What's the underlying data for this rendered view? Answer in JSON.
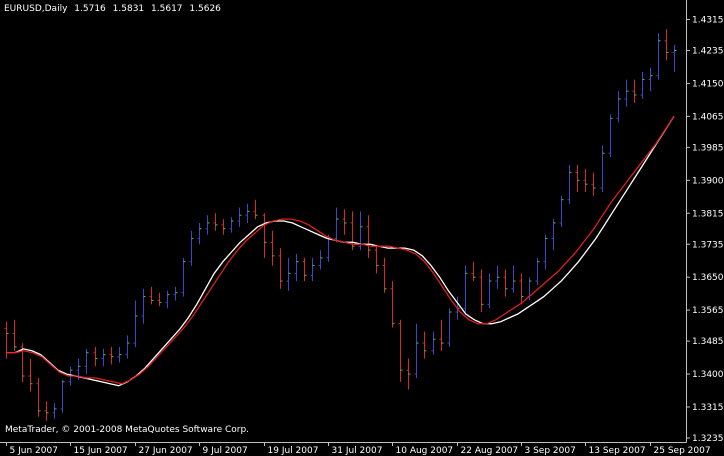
{
  "header": {
    "symbol": "EURUSD,Daily",
    "open": "1.5716",
    "high": "1.5831",
    "low": "1.5617",
    "close": "1.5626"
  },
  "copyright": "MetaTrader, © 2001-2008 MetaQuotes Software Corp.",
  "colors": {
    "background": "#000000",
    "axis": "#c0c0c0",
    "bar_up": "#3e45c8",
    "bar_down": "#d62a2a",
    "close_tick": "#3fd23f",
    "ma_fast": "#ffffff",
    "ma_slow": "#e01e1e"
  },
  "chart_data": {
    "type": "ohlc",
    "ylim": [
      1.3235,
      1.4355
    ],
    "y_ticks": [
      "1.4315",
      "1.4235",
      "1.4150",
      "1.4065",
      "1.3985",
      "1.3900",
      "1.3815",
      "1.3735",
      "1.3650",
      "1.3565",
      "1.3485",
      "1.3400",
      "1.3315",
      "1.3235"
    ],
    "x_tick_labels": [
      "5 Jun 2007",
      "15 Jun 2007",
      "27 Jun 2007",
      "9 Jul 2007",
      "19 Jul 2007",
      "31 Jul 2007",
      "10 Aug 2007",
      "22 Aug 2007",
      "3 Sep 2007",
      "13 Sep 2007",
      "25 Sep 2007"
    ],
    "x_tick_bar_index": [
      0,
      8,
      16,
      24,
      32,
      40,
      48,
      56,
      64,
      72,
      80
    ],
    "bars": [
      [
        1.3518,
        1.3535,
        1.344,
        1.3505
      ],
      [
        1.3505,
        1.354,
        1.346,
        1.347
      ],
      [
        1.347,
        1.348,
        1.338,
        1.3395
      ],
      [
        1.3395,
        1.344,
        1.3355,
        1.3375
      ],
      [
        1.3375,
        1.339,
        1.329,
        1.3305
      ],
      [
        1.3305,
        1.333,
        1.328,
        1.33
      ],
      [
        1.33,
        1.3325,
        1.3285,
        1.331
      ],
      [
        1.331,
        1.3385,
        1.33,
        1.338
      ],
      [
        1.338,
        1.342,
        1.337,
        1.341
      ],
      [
        1.341,
        1.344,
        1.3385,
        1.342
      ],
      [
        1.342,
        1.3465,
        1.34,
        1.3455
      ],
      [
        1.3455,
        1.347,
        1.342,
        1.344
      ],
      [
        1.344,
        1.3465,
        1.342,
        1.345
      ],
      [
        1.345,
        1.347,
        1.3425,
        1.3445
      ],
      [
        1.3445,
        1.347,
        1.343,
        1.345
      ],
      [
        1.345,
        1.35,
        1.344,
        1.348
      ],
      [
        1.348,
        1.359,
        1.347,
        1.355
      ],
      [
        1.355,
        1.362,
        1.353,
        1.36
      ],
      [
        1.36,
        1.3625,
        1.358,
        1.359
      ],
      [
        1.359,
        1.361,
        1.3575,
        1.3585
      ],
      [
        1.3585,
        1.3615,
        1.357,
        1.3605
      ],
      [
        1.3605,
        1.3625,
        1.359,
        1.361
      ],
      [
        1.361,
        1.37,
        1.36,
        1.369
      ],
      [
        1.369,
        1.377,
        1.368,
        1.375
      ],
      [
        1.375,
        1.379,
        1.3735,
        1.3775
      ],
      [
        1.3775,
        1.381,
        1.376,
        1.379
      ],
      [
        1.379,
        1.3815,
        1.377,
        1.3785
      ],
      [
        1.3785,
        1.38,
        1.376,
        1.3775
      ],
      [
        1.3775,
        1.3805,
        1.3765,
        1.3795
      ],
      [
        1.3795,
        1.383,
        1.378,
        1.381
      ],
      [
        1.381,
        1.384,
        1.379,
        1.382
      ],
      [
        1.382,
        1.385,
        1.38,
        1.381
      ],
      [
        1.381,
        1.3815,
        1.37,
        1.374
      ],
      [
        1.374,
        1.377,
        1.368,
        1.3705
      ],
      [
        1.3705,
        1.3725,
        1.362,
        1.364
      ],
      [
        1.364,
        1.37,
        1.3615,
        1.366
      ],
      [
        1.366,
        1.371,
        1.364,
        1.369
      ],
      [
        1.369,
        1.37,
        1.364,
        1.3655
      ],
      [
        1.3655,
        1.37,
        1.364,
        1.368
      ],
      [
        1.368,
        1.372,
        1.367,
        1.37
      ],
      [
        1.37,
        1.376,
        1.369,
        1.375
      ],
      [
        1.375,
        1.383,
        1.374,
        1.38
      ],
      [
        1.38,
        1.3825,
        1.376,
        1.379
      ],
      [
        1.379,
        1.382,
        1.372,
        1.373
      ],
      [
        1.373,
        1.382,
        1.372,
        1.378
      ],
      [
        1.378,
        1.381,
        1.37,
        1.372
      ],
      [
        1.372,
        1.373,
        1.366,
        1.368
      ],
      [
        1.368,
        1.37,
        1.361,
        1.362
      ],
      [
        1.362,
        1.364,
        1.352,
        1.353
      ],
      [
        1.353,
        1.354,
        1.338,
        1.341
      ],
      [
        1.341,
        1.344,
        1.336,
        1.34
      ],
      [
        1.34,
        1.353,
        1.339,
        1.348
      ],
      [
        1.348,
        1.351,
        1.344,
        1.346
      ],
      [
        1.346,
        1.351,
        1.345,
        1.349
      ],
      [
        1.349,
        1.354,
        1.346,
        1.348
      ],
      [
        1.348,
        1.357,
        1.347,
        1.356
      ],
      [
        1.356,
        1.36,
        1.354,
        1.357
      ],
      [
        1.357,
        1.368,
        1.356,
        1.366
      ],
      [
        1.366,
        1.369,
        1.364,
        1.365
      ],
      [
        1.365,
        1.367,
        1.356,
        1.358
      ],
      [
        1.358,
        1.366,
        1.357,
        1.364
      ],
      [
        1.364,
        1.368,
        1.362,
        1.365
      ],
      [
        1.365,
        1.367,
        1.36,
        1.362
      ],
      [
        1.362,
        1.368,
        1.361,
        1.364
      ],
      [
        1.364,
        1.366,
        1.358,
        1.36
      ],
      [
        1.36,
        1.365,
        1.359,
        1.364
      ],
      [
        1.364,
        1.37,
        1.363,
        1.369
      ],
      [
        1.369,
        1.376,
        1.367,
        1.375
      ],
      [
        1.375,
        1.38,
        1.372,
        1.379
      ],
      [
        1.379,
        1.386,
        1.378,
        1.385
      ],
      [
        1.385,
        1.394,
        1.384,
        1.392
      ],
      [
        1.392,
        1.394,
        1.387,
        1.39
      ],
      [
        1.39,
        1.393,
        1.387,
        1.389
      ],
      [
        1.389,
        1.392,
        1.386,
        1.388
      ],
      [
        1.388,
        1.399,
        1.387,
        1.397
      ],
      [
        1.397,
        1.407,
        1.396,
        1.406
      ],
      [
        1.406,
        1.413,
        1.405,
        1.411
      ],
      [
        1.411,
        1.416,
        1.409,
        1.413
      ],
      [
        1.413,
        1.416,
        1.41,
        1.412
      ],
      [
        1.412,
        1.418,
        1.411,
        1.416
      ],
      [
        1.416,
        1.419,
        1.413,
        1.417
      ],
      [
        1.417,
        1.428,
        1.416,
        1.426
      ],
      [
        1.426,
        1.429,
        1.421,
        1.423
      ],
      [
        1.423,
        1.425,
        1.418,
        1.4235
      ]
    ],
    "series": [
      {
        "values": [
          1.3455,
          1.3455,
          1.3465,
          1.346,
          1.345,
          1.343,
          1.341,
          1.34,
          1.3395,
          1.339,
          1.3385,
          1.338,
          1.3375,
          1.337,
          1.338,
          1.3395,
          1.3415,
          1.344,
          1.3465,
          1.349,
          1.3515,
          1.3545,
          1.358,
          1.362,
          1.366,
          1.369,
          1.3715,
          1.374,
          1.376,
          1.378,
          1.379,
          1.3795,
          1.3795,
          1.379,
          1.378,
          1.377,
          1.376,
          1.375,
          1.3745,
          1.374,
          1.374,
          1.3735,
          1.3735,
          1.373,
          1.3725,
          1.3725,
          1.3725,
          1.372,
          1.3705,
          1.368,
          1.365,
          1.3615,
          1.3585,
          1.3555,
          1.354,
          1.353,
          1.353,
          1.3535,
          1.3545,
          1.3555,
          1.357,
          1.3585,
          1.36,
          1.362,
          1.364,
          1.3665,
          1.369,
          1.372,
          1.375,
          1.3785,
          1.382,
          1.3855,
          1.389,
          1.3925,
          1.396,
          1.3995,
          1.403,
          1.4065
        ]
      },
      {
        "values": [
          1.3455,
          1.3455,
          1.346,
          1.3455,
          1.3445,
          1.3425,
          1.3405,
          1.3395,
          1.3395,
          1.339,
          1.339,
          1.3385,
          1.338,
          1.3375,
          1.3385,
          1.34,
          1.342,
          1.3445,
          1.347,
          1.3495,
          1.352,
          1.355,
          1.3585,
          1.362,
          1.3655,
          1.369,
          1.372,
          1.3745,
          1.3765,
          1.3785,
          1.3795,
          1.38,
          1.38,
          1.3795,
          1.3785,
          1.377,
          1.3755,
          1.3745,
          1.374,
          1.3735,
          1.3735,
          1.373,
          1.373,
          1.373,
          1.3725,
          1.372,
          1.371,
          1.369,
          1.366,
          1.3625,
          1.359,
          1.356,
          1.354,
          1.353,
          1.353,
          1.354,
          1.3555,
          1.357,
          1.3585,
          1.3605,
          1.3625,
          1.3645,
          1.3665,
          1.369,
          1.3715,
          1.3745,
          1.3775,
          1.381,
          1.3845,
          1.3875,
          1.3905,
          1.3935,
          1.3965,
          1.3995,
          1.403,
          1.4065
        ]
      }
    ]
  }
}
